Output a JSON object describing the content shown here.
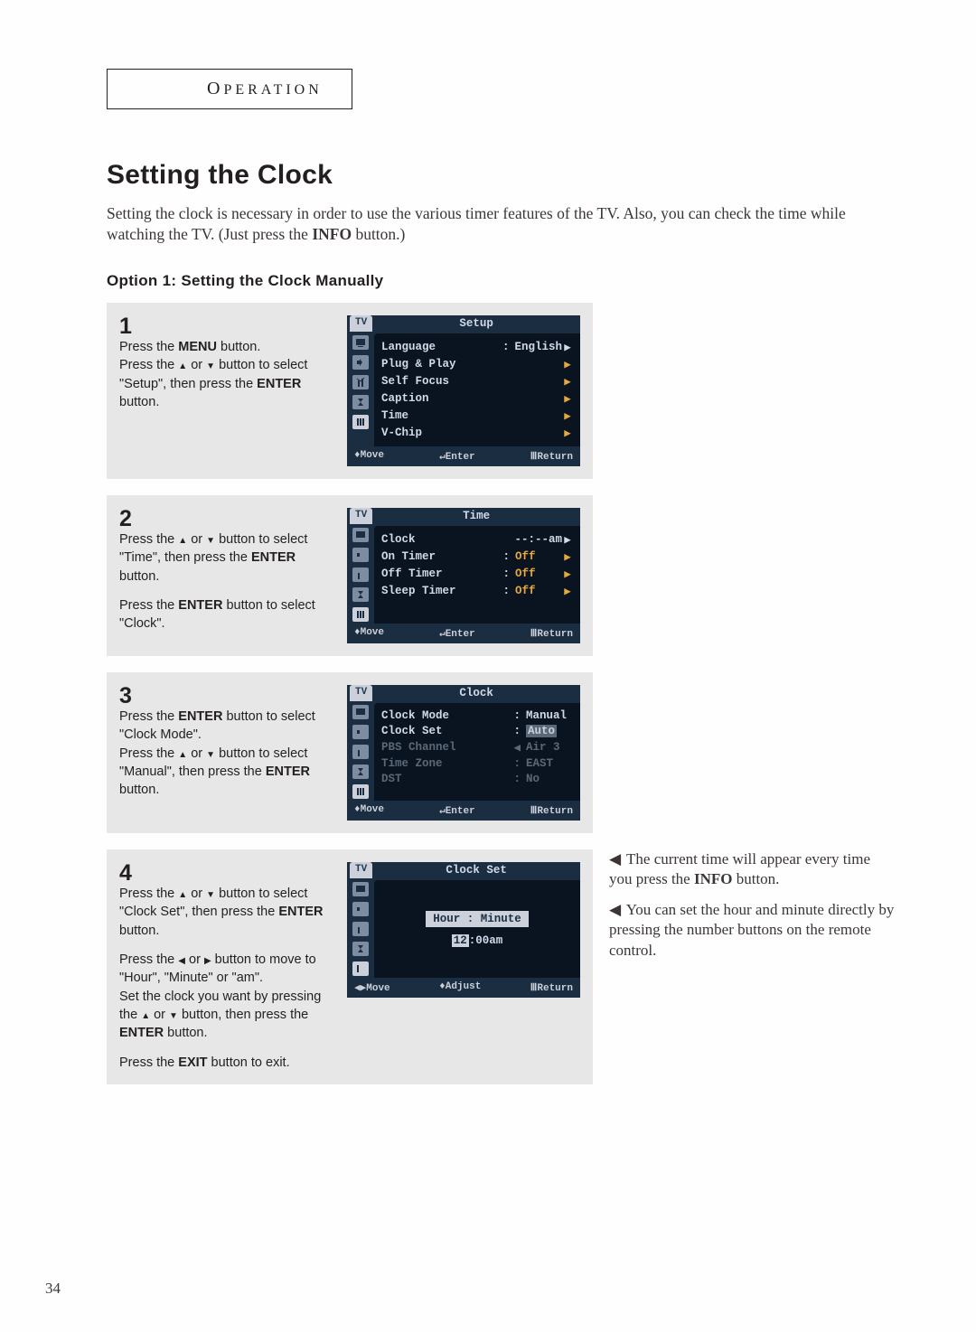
{
  "page": {
    "section_label": "OPERATION",
    "section_label_first": "O",
    "section_label_rest": "PERATION",
    "heading": "Setting the Clock",
    "intro": "Setting the clock is necessary in order to use the various timer features of the TV. Also, you can check the time while watching the TV. (Just press the INFO button.)",
    "sub_heading": "Option 1: Setting the Clock Manually",
    "page_number": "34"
  },
  "steps": {
    "1": {
      "num": "1",
      "text": "Press the MENU button.\nPress the ▲ or ▼ button to select \"Setup\", then press the ENTER button."
    },
    "2": {
      "num": "2",
      "text": "Press the ▲ or ▼ button to select \"Time\", then press the ENTER button.\n\nPress the ENTER button to select \"Clock\"."
    },
    "3": {
      "num": "3",
      "text": "Press the ENTER button to select \"Clock Mode\".\nPress the ▲ or ▼ button to select \"Manual\", then press the ENTER button."
    },
    "4": {
      "num": "4",
      "text": "Press the ▲ or ▼ button to select \"Clock Set\", then press the ENTER button.\n\nPress the ◀ or ▶ button to move to \"Hour\", \"Minute\" or \"am\".\nSet the clock you want by pressing the ▲ or ▼ button, then press the ENTER button.\n\nPress the EXIT button to exit."
    }
  },
  "osd": {
    "tv_tab": "TV",
    "footer_move": "Move",
    "footer_enter": "Enter",
    "footer_return": "Return",
    "footer_adjust": "Adjust",
    "menu1": {
      "title": "Setup",
      "rows": [
        {
          "label": "Language",
          "colon": ":",
          "val": "English",
          "arrow": "▶"
        },
        {
          "label": "Plug & Play",
          "arrow": "▶",
          "hi": true
        },
        {
          "label": "Self Focus",
          "arrow": "▶",
          "hi": true
        },
        {
          "label": "Caption",
          "arrow": "▶",
          "hi": true
        },
        {
          "label": "Time",
          "arrow": "▶",
          "hi": true
        },
        {
          "label": "V-Chip",
          "arrow": "▶",
          "hi": true
        }
      ]
    },
    "menu2": {
      "title": "Time",
      "rows": [
        {
          "label": "Clock",
          "val": "--:--am",
          "arrow": "▶"
        },
        {
          "label": "On Timer",
          "colon": ":",
          "val": "Off",
          "arrow": "▶",
          "hi": true
        },
        {
          "label": "Off Timer",
          "colon": ":",
          "val": "Off",
          "arrow": "▶",
          "hi": true
        },
        {
          "label": "Sleep Timer",
          "colon": ":",
          "val": "Off",
          "arrow": "▶",
          "hi": true
        }
      ]
    },
    "menu3": {
      "title": "Clock",
      "rows": [
        {
          "label": "Clock Mode",
          "colon": ":",
          "val": "Manual"
        },
        {
          "label": "Clock Set",
          "colon": ":",
          "val": "Auto",
          "dim": true,
          "valbox": true
        },
        {
          "label": "PBS Channel",
          "lead": "◀",
          "val": "Air   3",
          "dim": true
        },
        {
          "label": "Time Zone",
          "colon": ":",
          "val": "EAST",
          "dim": true
        },
        {
          "label": "DST",
          "colon": ":",
          "val": "No",
          "dim": true
        }
      ]
    },
    "menu4": {
      "title": "Clock Set",
      "hm_label": "Hour : Minute",
      "time_hl": "12",
      "time_rest": ":00am"
    }
  },
  "notes": {
    "n1": "The current time will appear every time you press the INFO button.",
    "n2": "You can set the hour and minute directly by pressing the number buttons on the remote control."
  }
}
